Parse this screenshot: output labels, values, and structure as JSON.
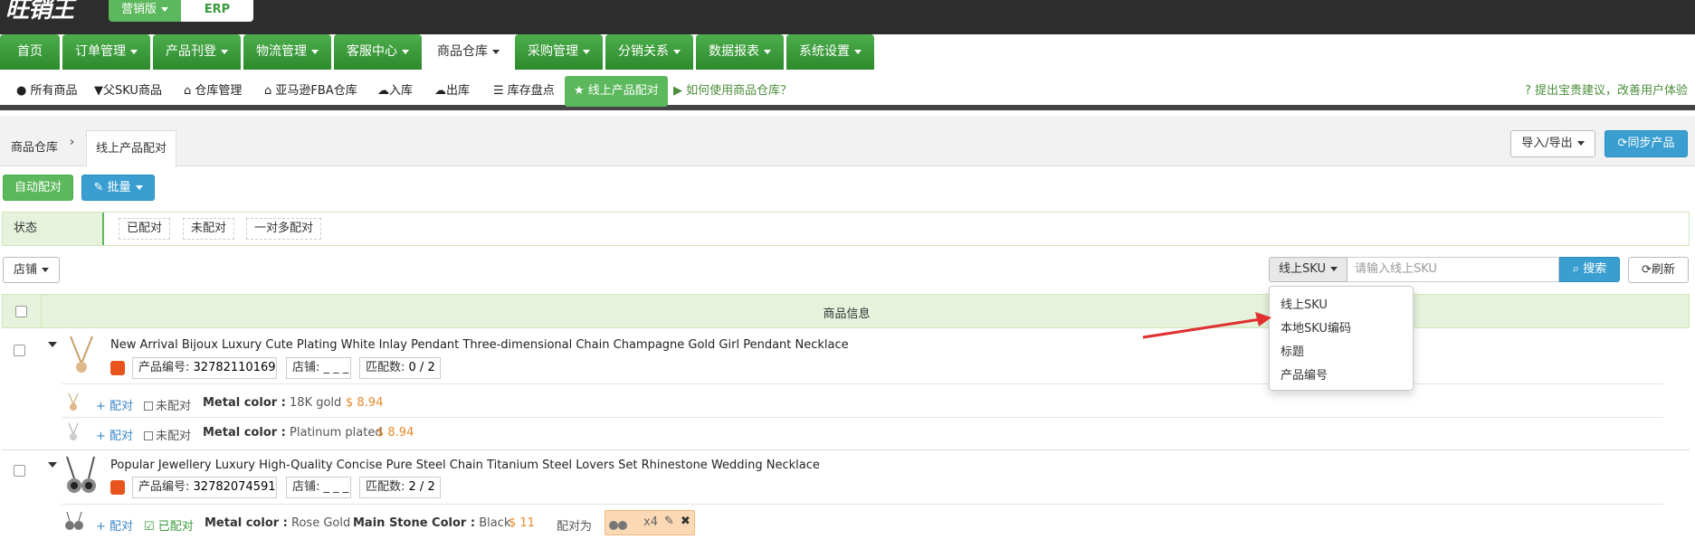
{
  "topbar": {
    "logo": "旺销王",
    "edition": "营销版",
    "erp": "ERP"
  },
  "main_nav": [
    {
      "label": "首页",
      "dropdown": false,
      "active": false
    },
    {
      "label": "订单管理",
      "dropdown": true,
      "active": false
    },
    {
      "label": "产品刊登",
      "dropdown": true,
      "active": false
    },
    {
      "label": "物流管理",
      "dropdown": true,
      "active": false
    },
    {
      "label": "客服中心",
      "dropdown": true,
      "active": false
    },
    {
      "label": "商品仓库",
      "dropdown": true,
      "active": true
    },
    {
      "label": "采购管理",
      "dropdown": true,
      "active": false
    },
    {
      "label": "分销关系",
      "dropdown": true,
      "active": false
    },
    {
      "label": "数据报表",
      "dropdown": true,
      "active": false
    },
    {
      "label": "系统设置",
      "dropdown": true,
      "active": false
    }
  ],
  "sub_nav": {
    "all_products": "所有商品",
    "parent_sku": "父SKU商品",
    "warehouse_mgmt": "仓库管理",
    "amazon_fba": "亚马逊FBA仓库",
    "inbound": "入库",
    "outbound": "出库",
    "stocktake": "库存盘点",
    "online_pairing": "线上产品配对",
    "howto": "如何使用商品仓库？",
    "feedback": "提出宝贵建议，改善用户体验"
  },
  "breadcrumb": {
    "root": "商品仓库",
    "sep": "›",
    "current": "线上产品配对"
  },
  "actions": {
    "import_export": "导入/导出",
    "sync": "同步产品",
    "auto_pair": "自动配对",
    "batch": "批量"
  },
  "status_filter": {
    "label": "状态",
    "options": [
      "已配对",
      "未配对",
      "一对多配对"
    ]
  },
  "shop_filter": "店铺",
  "search": {
    "field_label": "线上SKU",
    "placeholder": "请输入线上SKU",
    "search_button": "搜索",
    "refresh_button": "刷新",
    "options": [
      "线上SKU",
      "本地SKU编码",
      "标题",
      "产品编号"
    ]
  },
  "table": {
    "header": "商品信息",
    "products": [
      {
        "title": "New Arrival Bijoux Luxury Cute Plating White Inlay Pendant Three-dimensional Chain Champagne Gold Girl Pendant Necklace",
        "product_no_label": "产品编号:",
        "product_no": "32782110169",
        "shop_label": "店铺:",
        "shop": "_ _ _",
        "match_label": "匹配数:",
        "match": "0 / 2",
        "variants": [
          {
            "pair": "配对",
            "state": "未配对",
            "attr_name": "Metal color :",
            "attr_value": "18K gold",
            "price": "$ 8.94"
          },
          {
            "pair": "配对",
            "state": "未配对",
            "attr_name": "Metal color :",
            "attr_value": "Platinum plated",
            "price": "$ 8.94"
          }
        ]
      },
      {
        "title": "Popular Jewellery Luxury High-Quality Concise Pure Steel Chain Titanium Steel Lovers Set Rhinestone Wedding Necklace",
        "product_no_label": "产品编号:",
        "product_no": "32782074591",
        "shop_label": "店铺:",
        "shop": "_ _ _",
        "match_label": "匹配数:",
        "match": "2 / 2",
        "variants": [
          {
            "pair": "配对",
            "state": "已配对",
            "attr_name": "Metal color :",
            "attr_value": "Rose Gold",
            "attr2_name": "Main Stone Color :",
            "attr2_value": "Black",
            "price": "$ 11",
            "paired_to_label": "配对为",
            "qty": "x4"
          }
        ]
      }
    ]
  },
  "colors": {
    "green": "#4cae4c",
    "blue": "#3a9fd0",
    "orange": "#e8892a",
    "arrow": "#e03030"
  }
}
